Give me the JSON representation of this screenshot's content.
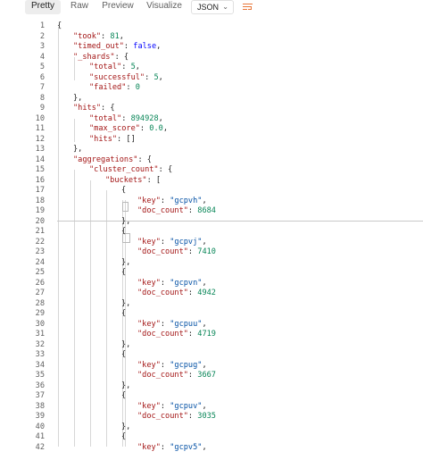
{
  "toolbar": {
    "tabs": [
      "Pretty",
      "Raw",
      "Preview",
      "Visualize"
    ],
    "active_tab": "Pretty",
    "format_select": "JSON",
    "wrap_icon": "wrap-lines-icon"
  },
  "editor": {
    "lines": [
      {
        "n": "1",
        "indent": 0,
        "tokens": [
          [
            "p",
            "{"
          ]
        ]
      },
      {
        "n": "2",
        "indent": 1,
        "tokens": [
          [
            "k",
            "\"took\""
          ],
          [
            "p",
            ": "
          ],
          [
            "n",
            "81"
          ],
          [
            "p",
            ","
          ]
        ]
      },
      {
        "n": "3",
        "indent": 1,
        "tokens": [
          [
            "k",
            "\"timed_out\""
          ],
          [
            "p",
            ": "
          ],
          [
            "w",
            "false"
          ],
          [
            "p",
            ","
          ]
        ]
      },
      {
        "n": "4",
        "indent": 1,
        "tokens": [
          [
            "k",
            "\"_shards\""
          ],
          [
            "p",
            ": {"
          ]
        ]
      },
      {
        "n": "5",
        "indent": 2,
        "tokens": [
          [
            "k",
            "\"total\""
          ],
          [
            "p",
            ": "
          ],
          [
            "n",
            "5"
          ],
          [
            "p",
            ","
          ]
        ]
      },
      {
        "n": "6",
        "indent": 2,
        "tokens": [
          [
            "k",
            "\"successful\""
          ],
          [
            "p",
            ": "
          ],
          [
            "n",
            "5"
          ],
          [
            "p",
            ","
          ]
        ]
      },
      {
        "n": "7",
        "indent": 2,
        "tokens": [
          [
            "k",
            "\"failed\""
          ],
          [
            "p",
            ": "
          ],
          [
            "n",
            "0"
          ]
        ]
      },
      {
        "n": "8",
        "indent": 1,
        "tokens": [
          [
            "p",
            "},"
          ]
        ]
      },
      {
        "n": "9",
        "indent": 1,
        "tokens": [
          [
            "k",
            "\"hits\""
          ],
          [
            "p",
            ": {"
          ]
        ]
      },
      {
        "n": "10",
        "indent": 2,
        "tokens": [
          [
            "k",
            "\"total\""
          ],
          [
            "p",
            ": "
          ],
          [
            "n",
            "894928"
          ],
          [
            "p",
            ","
          ]
        ]
      },
      {
        "n": "11",
        "indent": 2,
        "tokens": [
          [
            "k",
            "\"max_score\""
          ],
          [
            "p",
            ": "
          ],
          [
            "n",
            "0.0"
          ],
          [
            "p",
            ","
          ]
        ]
      },
      {
        "n": "12",
        "indent": 2,
        "tokens": [
          [
            "k",
            "\"hits\""
          ],
          [
            "p",
            ": []"
          ]
        ]
      },
      {
        "n": "13",
        "indent": 1,
        "tokens": [
          [
            "p",
            "},"
          ]
        ]
      },
      {
        "n": "14",
        "indent": 1,
        "tokens": [
          [
            "k",
            "\"aggregations\""
          ],
          [
            "p",
            ": {"
          ]
        ]
      },
      {
        "n": "15",
        "indent": 2,
        "tokens": [
          [
            "k",
            "\"cluster_count\""
          ],
          [
            "p",
            ": {"
          ]
        ]
      },
      {
        "n": "16",
        "indent": 3,
        "tokens": [
          [
            "k",
            "\"buckets\""
          ],
          [
            "p",
            ": ["
          ]
        ]
      },
      {
        "n": "17",
        "indent": 4,
        "tokens": [
          [
            "p",
            "{"
          ]
        ]
      },
      {
        "n": "18",
        "indent": 5,
        "tokens": [
          [
            "k",
            "\"key\""
          ],
          [
            "p",
            ": "
          ],
          [
            "s",
            "\"gcpvh\""
          ],
          [
            "p",
            ","
          ]
        ]
      },
      {
        "n": "19",
        "indent": 5,
        "tokens": [
          [
            "k",
            "\"doc_count\""
          ],
          [
            "p",
            ": "
          ],
          [
            "n",
            "8684"
          ]
        ]
      },
      {
        "n": "20",
        "indent": 4,
        "tokens": [
          [
            "p",
            "},"
          ]
        ]
      },
      {
        "n": "21",
        "indent": 4,
        "tokens": [
          [
            "p",
            "{"
          ]
        ]
      },
      {
        "n": "22",
        "indent": 5,
        "tokens": [
          [
            "k",
            "\"key\""
          ],
          [
            "p",
            ": "
          ],
          [
            "s",
            "\"gcpvj\""
          ],
          [
            "p",
            ","
          ]
        ]
      },
      {
        "n": "23",
        "indent": 5,
        "tokens": [
          [
            "k",
            "\"doc_count\""
          ],
          [
            "p",
            ": "
          ],
          [
            "n",
            "7410"
          ]
        ]
      },
      {
        "n": "24",
        "indent": 4,
        "tokens": [
          [
            "p",
            "},"
          ]
        ]
      },
      {
        "n": "25",
        "indent": 4,
        "tokens": [
          [
            "p",
            "{"
          ]
        ]
      },
      {
        "n": "26",
        "indent": 5,
        "tokens": [
          [
            "k",
            "\"key\""
          ],
          [
            "p",
            ": "
          ],
          [
            "s",
            "\"gcpvn\""
          ],
          [
            "p",
            ","
          ]
        ]
      },
      {
        "n": "27",
        "indent": 5,
        "tokens": [
          [
            "k",
            "\"doc_count\""
          ],
          [
            "p",
            ": "
          ],
          [
            "n",
            "4942"
          ]
        ]
      },
      {
        "n": "28",
        "indent": 4,
        "tokens": [
          [
            "p",
            "},"
          ]
        ]
      },
      {
        "n": "29",
        "indent": 4,
        "tokens": [
          [
            "p",
            "{"
          ]
        ]
      },
      {
        "n": "30",
        "indent": 5,
        "tokens": [
          [
            "k",
            "\"key\""
          ],
          [
            "p",
            ": "
          ],
          [
            "s",
            "\"gcpuu\""
          ],
          [
            "p",
            ","
          ]
        ]
      },
      {
        "n": "31",
        "indent": 5,
        "tokens": [
          [
            "k",
            "\"doc_count\""
          ],
          [
            "p",
            ": "
          ],
          [
            "n",
            "4719"
          ]
        ]
      },
      {
        "n": "32",
        "indent": 4,
        "tokens": [
          [
            "p",
            "},"
          ]
        ]
      },
      {
        "n": "33",
        "indent": 4,
        "tokens": [
          [
            "p",
            "{"
          ]
        ]
      },
      {
        "n": "34",
        "indent": 5,
        "tokens": [
          [
            "k",
            "\"key\""
          ],
          [
            "p",
            ": "
          ],
          [
            "s",
            "\"gcpug\""
          ],
          [
            "p",
            ","
          ]
        ]
      },
      {
        "n": "35",
        "indent": 5,
        "tokens": [
          [
            "k",
            "\"doc_count\""
          ],
          [
            "p",
            ": "
          ],
          [
            "n",
            "3667"
          ]
        ]
      },
      {
        "n": "36",
        "indent": 4,
        "tokens": [
          [
            "p",
            "},"
          ]
        ]
      },
      {
        "n": "37",
        "indent": 4,
        "tokens": [
          [
            "p",
            "{"
          ]
        ]
      },
      {
        "n": "38",
        "indent": 5,
        "tokens": [
          [
            "k",
            "\"key\""
          ],
          [
            "p",
            ": "
          ],
          [
            "s",
            "\"gcpuv\""
          ],
          [
            "p",
            ","
          ]
        ]
      },
      {
        "n": "39",
        "indent": 5,
        "tokens": [
          [
            "k",
            "\"doc_count\""
          ],
          [
            "p",
            ": "
          ],
          [
            "n",
            "3035"
          ]
        ]
      },
      {
        "n": "40",
        "indent": 4,
        "tokens": [
          [
            "p",
            "},"
          ]
        ]
      },
      {
        "n": "41",
        "indent": 4,
        "tokens": [
          [
            "p",
            "{"
          ]
        ]
      },
      {
        "n": "42",
        "indent": 5,
        "tokens": [
          [
            "k",
            "\"key\""
          ],
          [
            "p",
            ": "
          ],
          [
            "s",
            "\"gcpv5\""
          ],
          [
            "p",
            ","
          ]
        ]
      }
    ]
  }
}
